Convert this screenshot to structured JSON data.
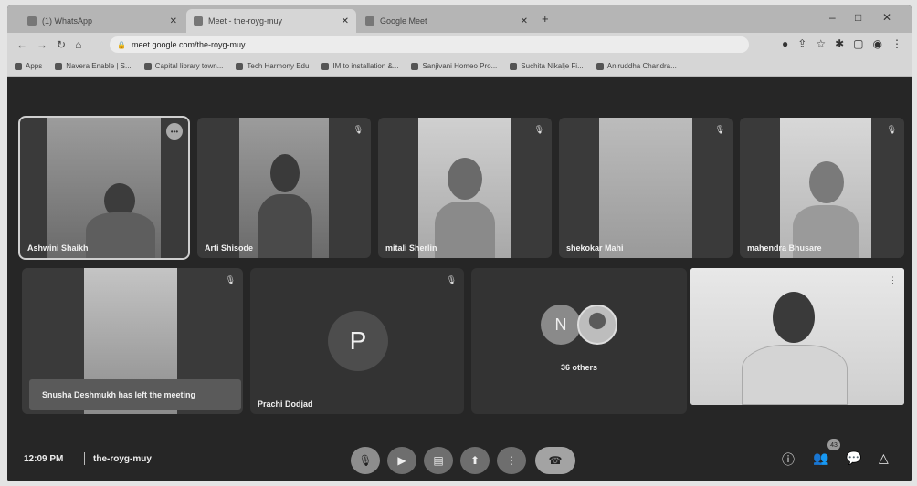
{
  "browser": {
    "tabs": [
      {
        "label": "(1) WhatsApp"
      },
      {
        "label": "Meet - the-royg-muy"
      },
      {
        "label": "Google Meet"
      }
    ],
    "url": "meet.google.com/the-royg-muy",
    "bookmarks": [
      "Apps",
      "Navera Enable | S...",
      "Capital library town...",
      "Tech Harmony Edu",
      "IM to installation &...",
      "Sanjivani Homeo Pro...",
      "Suchita Nikalje Fi...",
      "Aniruddha Chandra..."
    ]
  },
  "meet": {
    "participants_row1": [
      {
        "name": "Ashwini Shaikh"
      },
      {
        "name": "Arti Shisode"
      },
      {
        "name": "mitali Sherlin"
      },
      {
        "name": "shekokar Mahi"
      },
      {
        "name": "mahendra Bhusare"
      }
    ],
    "participant_vid6": {
      "name": ""
    },
    "notice": "Snusha Deshmukh has left the meeting",
    "participant_prachi": {
      "name": "Prachi Dodjad",
      "initial": "P"
    },
    "others": {
      "initial": "N",
      "label": "36 others"
    },
    "bottom_bar": {
      "time": "12:09 PM",
      "meeting_code": "the-royg-muy",
      "participants_count": "43"
    }
  }
}
